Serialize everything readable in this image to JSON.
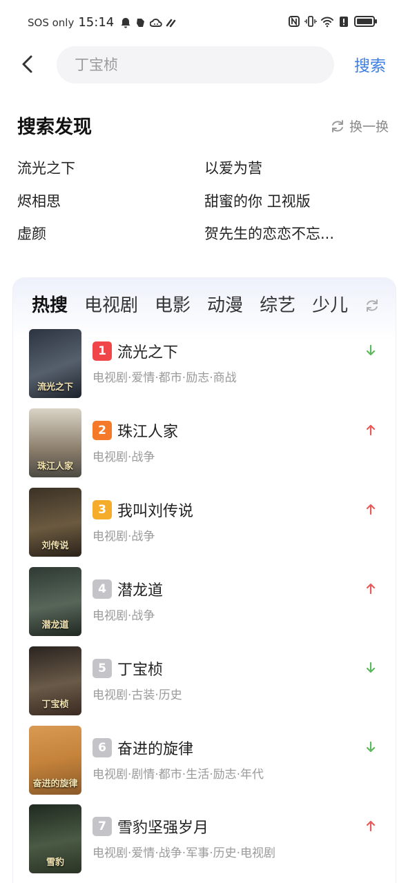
{
  "status_bar": {
    "carrier": "SOS only",
    "time": "15:14"
  },
  "search": {
    "placeholder": "丁宝桢",
    "button_label": "搜索"
  },
  "discover": {
    "title": "搜索发现",
    "refresh_label": "换一换",
    "items": [
      "流光之下",
      "以爱为营",
      "烬相思",
      "甜蜜的你 卫视版",
      "虚颜",
      "贺先生的恋恋不忘..."
    ]
  },
  "hot": {
    "tabs": [
      "热搜",
      "电视剧",
      "电影",
      "动漫",
      "综艺",
      "少儿"
    ],
    "items": [
      {
        "rank": "1",
        "title": "流光之下",
        "tags": "电视剧·爱情·都市·励志·商战",
        "trend": "down",
        "badge_color": "#f0464a",
        "poster_title": "流光之下"
      },
      {
        "rank": "2",
        "title": "珠江人家",
        "tags": "电视剧·战争",
        "trend": "up",
        "badge_color": "#f4792a",
        "poster_title": "珠江人家"
      },
      {
        "rank": "3",
        "title": "我叫刘传说",
        "tags": "电视剧·战争",
        "trend": "up",
        "badge_color": "#f5ac2b",
        "poster_title": "刘传说"
      },
      {
        "rank": "4",
        "title": "潜龙道",
        "tags": "电视剧·战争",
        "trend": "up",
        "badge_color": "#c4c4c8",
        "poster_title": "潜龙道"
      },
      {
        "rank": "5",
        "title": "丁宝桢",
        "tags": "电视剧·古装·历史",
        "trend": "down",
        "badge_color": "#c4c4c8",
        "poster_title": "丁宝桢"
      },
      {
        "rank": "6",
        "title": "奋进的旋律",
        "tags": "电视剧·剧情·都市·生活·励志·年代",
        "trend": "down",
        "badge_color": "#c4c4c8",
        "poster_title": "奋进的旋律"
      },
      {
        "rank": "7",
        "title": "雪豹坚强岁月",
        "tags": "电视剧·爱情·战争·军事·历史·电视剧",
        "trend": "up",
        "badge_color": "#c4c4c8",
        "poster_title": "雪豹"
      }
    ]
  },
  "colors": {
    "accent": "#3d7fe0",
    "trend_up": "#e85a5a",
    "trend_down": "#5cb85c"
  },
  "icons": [
    "back-arrow-icon",
    "refresh-icon",
    "trend-up-icon",
    "trend-down-icon",
    "bell-icon",
    "nfc-icon",
    "vibrate-icon",
    "wifi-icon",
    "alert-icon",
    "battery-icon"
  ]
}
